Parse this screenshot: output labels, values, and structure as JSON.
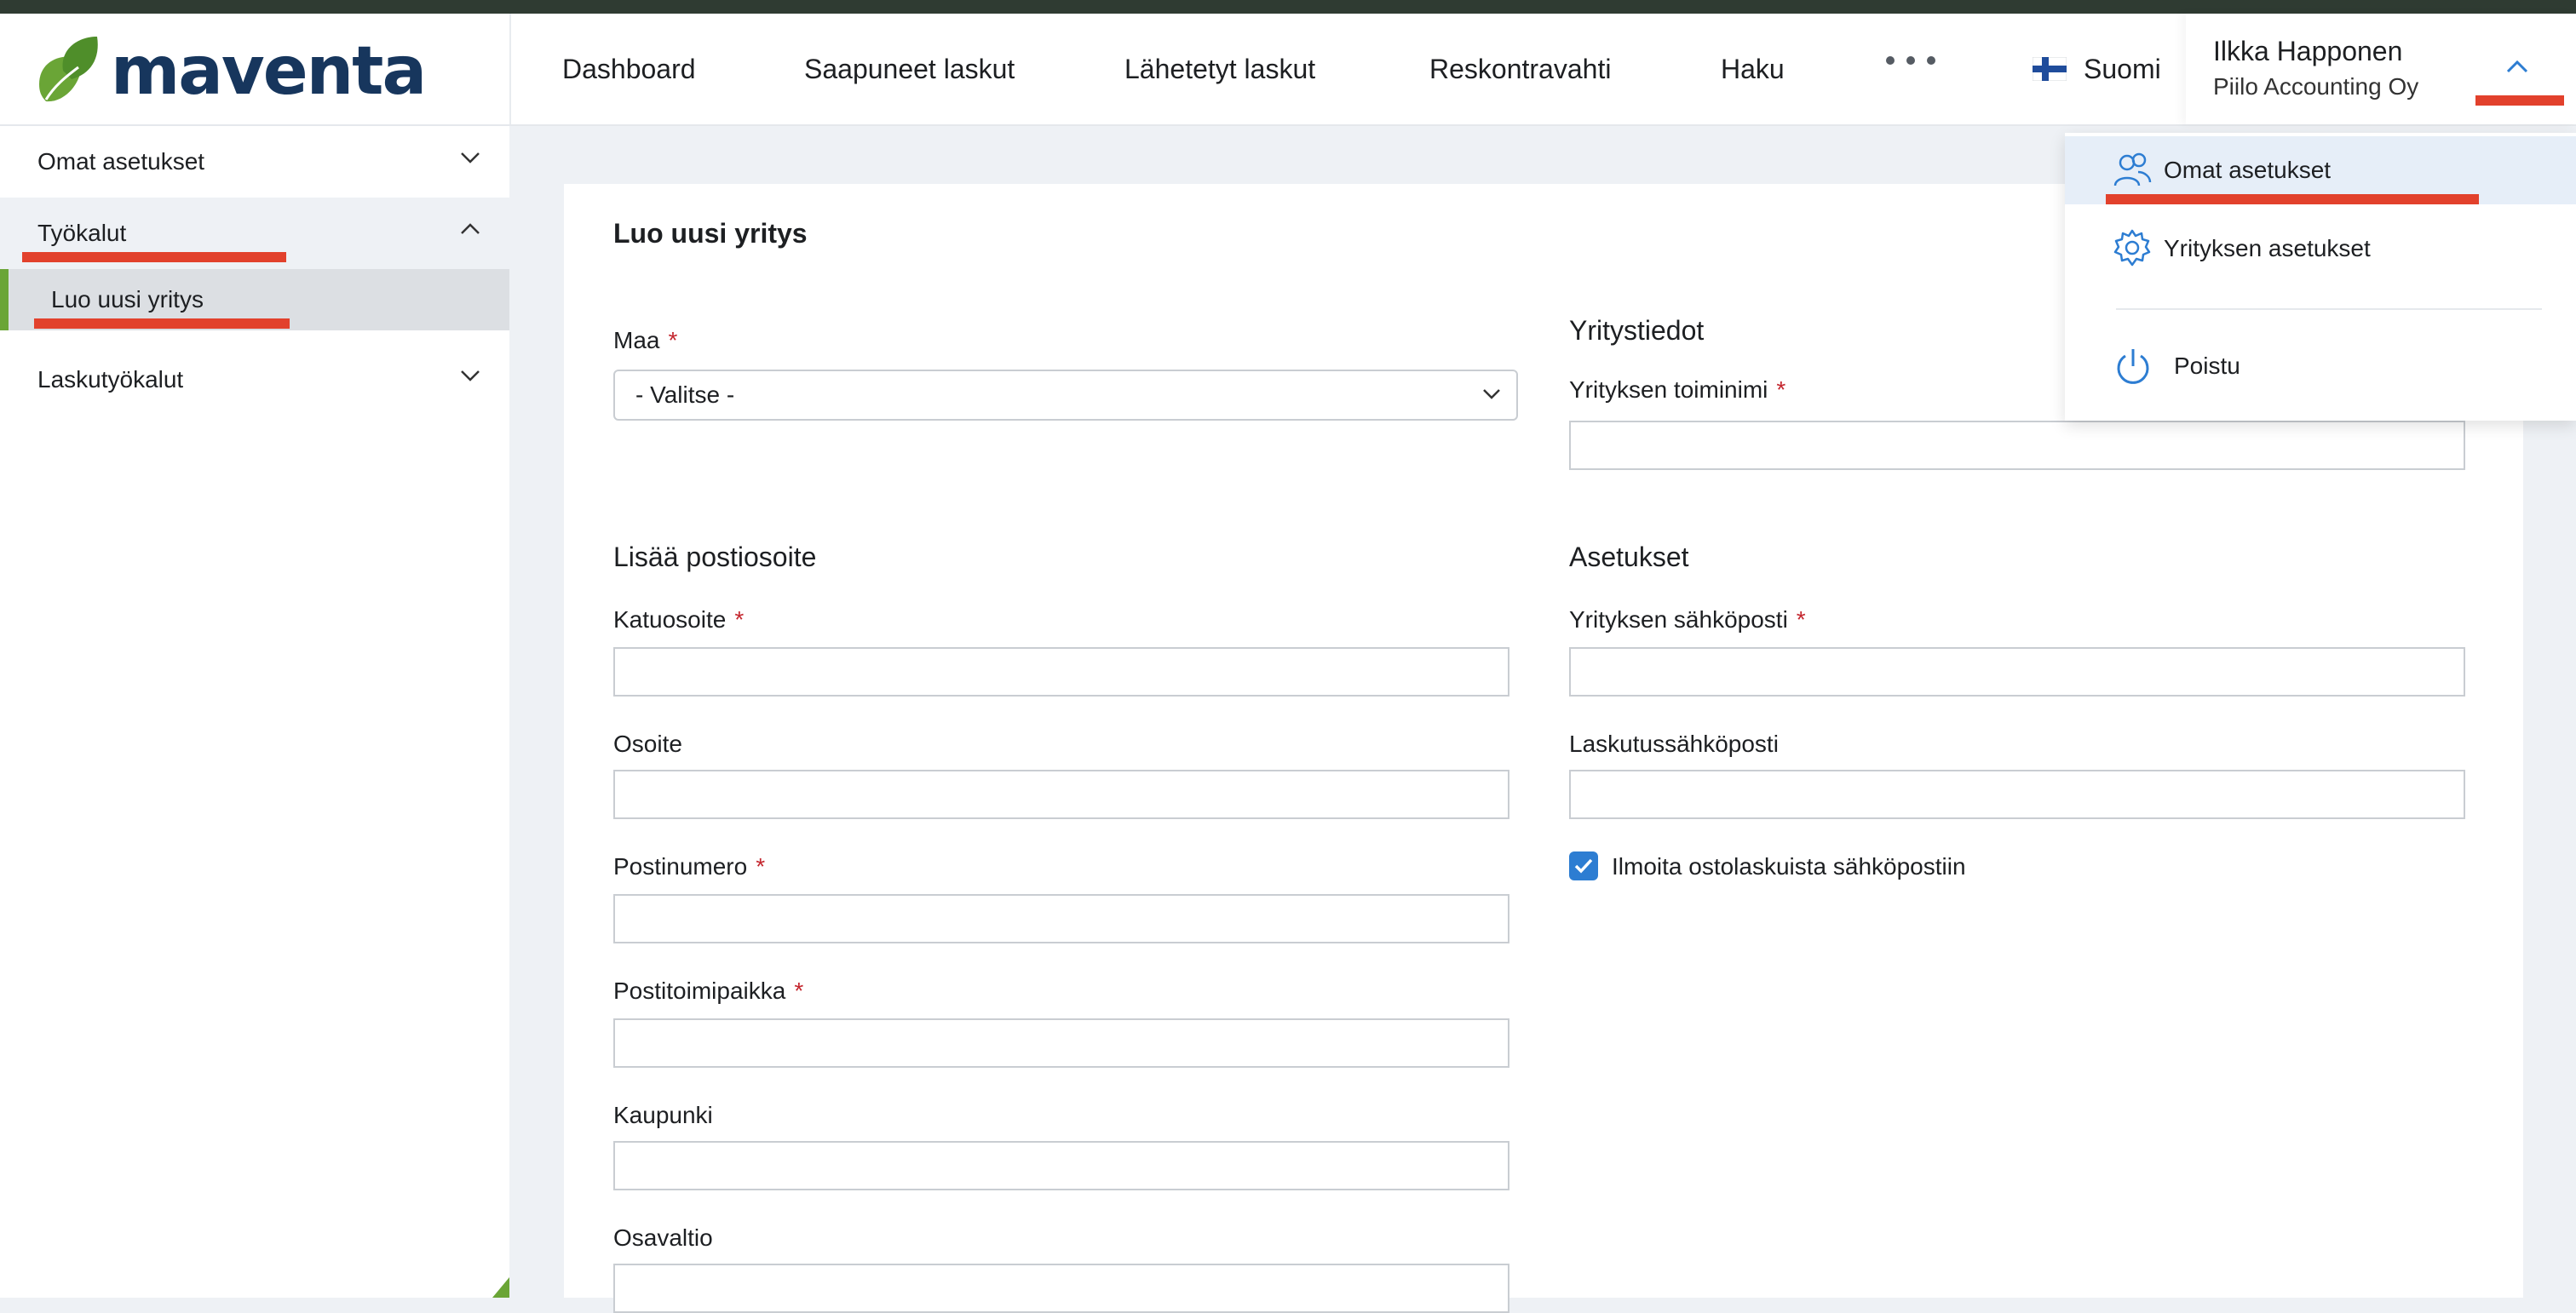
{
  "brand": {
    "name": "maventa"
  },
  "nav": {
    "items": [
      "Dashboard",
      "Saapuneet laskut",
      "Lähetetyt laskut",
      "Reskontravahti",
      "Haku"
    ],
    "more_icon": "ellipsis-icon",
    "language": "Suomi",
    "language_flag": "finland-flag-icon"
  },
  "user": {
    "name": "Ilkka Happonen",
    "company": "Piilo Accounting Oy"
  },
  "user_menu": {
    "items": [
      {
        "label": "Omat asetukset",
        "icon": "users-icon"
      },
      {
        "label": "Yrityksen asetukset",
        "icon": "gear-icon"
      },
      {
        "label": "Poistu",
        "icon": "power-icon"
      }
    ]
  },
  "sidebar": {
    "items": [
      {
        "label": "Omat asetukset"
      },
      {
        "label": "Työkalut",
        "children": [
          {
            "label": "Luo uusi yritys"
          }
        ]
      },
      {
        "label": "Laskutyökalut"
      }
    ]
  },
  "form": {
    "title": "Luo uusi yritys",
    "country": {
      "label": "Maa",
      "value": "- Valitse -"
    },
    "address_section": "Lisää postiosoite",
    "address_fields": [
      {
        "label": "Katuosoite",
        "required": true,
        "value": ""
      },
      {
        "label": "Osoite",
        "required": false,
        "value": ""
      },
      {
        "label": "Postinumero",
        "required": true,
        "value": ""
      },
      {
        "label": "Postitoimipaikka",
        "required": true,
        "value": ""
      },
      {
        "label": "Kaupunki",
        "required": false,
        "value": ""
      },
      {
        "label": "Osavaltio",
        "required": false,
        "value": ""
      }
    ],
    "company_section": "Yritystiedot",
    "company_name": {
      "label": "Yrityksen toiminimi",
      "value": ""
    },
    "settings_section": "Asetukset",
    "company_email": {
      "label": "Yrityksen sähköposti",
      "value": ""
    },
    "billing_email": {
      "label": "Laskutussähköposti",
      "value": ""
    },
    "notify": {
      "label": "Ilmoita ostolaskuista sähköpostiin",
      "checked": true
    }
  },
  "required_marker": "*",
  "colors": {
    "brand_green": "#6aa536",
    "brand_navy": "#17365d",
    "accent_blue": "#2d7dd2",
    "highlight_red": "#e2412c"
  }
}
